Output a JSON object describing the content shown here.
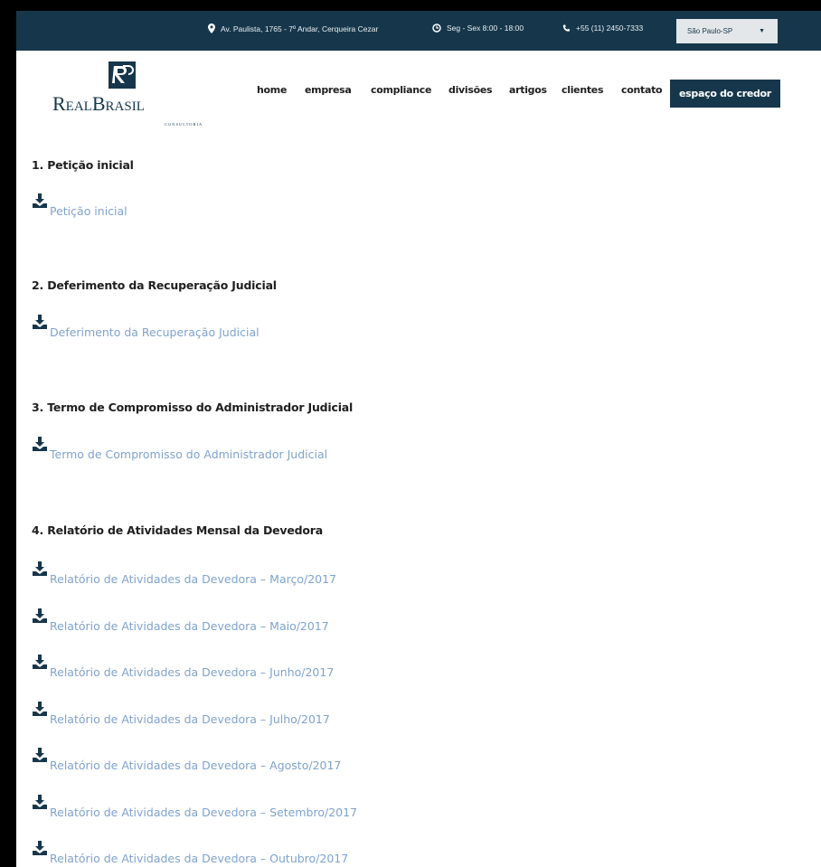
{
  "topbar": {
    "address": "Av. Paulista, 1765 - 7º Andar, Cerqueira Cezar",
    "hours": "Seg - Sex 8:00 - 18:00",
    "phone": "+55 (11) 2450-7333",
    "city": "São Paulo-SP",
    "caret": "▼"
  },
  "logo": {
    "name_part1": "Real",
    "name_part2": "Brasil",
    "tagline": "CONSULTORIA"
  },
  "nav": {
    "home": "home",
    "empresa": "empresa",
    "compliance": "compliance",
    "divisoes": "divisões",
    "artigos": "artigos",
    "clientes": "clientes",
    "contato": "contato",
    "credor": "espaço do credor"
  },
  "sections": [
    {
      "title": "1. Petição inicial",
      "docs": [
        "Petição inicial"
      ]
    },
    {
      "title": "2. Deferimento da Recuperação Judicial",
      "docs": [
        "Deferimento da Recuperação Judicial"
      ]
    },
    {
      "title": "3. Termo de Compromisso do Administrador Judicial",
      "docs": [
        "Termo de Compromisso do Administrador Judicial"
      ]
    },
    {
      "title": "4. Relatório de Atividades Mensal da Devedora",
      "docs": [
        "Relatório de Atividades da Devedora – Março/2017",
        "Relatório de Atividades da Devedora – Maio/2017",
        "Relatório de Atividades da Devedora – Junho/2017",
        "Relatório de Atividades da Devedora – Julho/2017",
        "Relatório de Atividades da Devedora – Agosto/2017",
        "Relatório de Atividades da Devedora – Setembro/2017",
        "Relatório de Atividades da Devedora – Outubro/2017"
      ]
    }
  ],
  "colors": {
    "brand": "#16374b",
    "link": "#7fa3cc",
    "text": "#1f1f1f"
  }
}
